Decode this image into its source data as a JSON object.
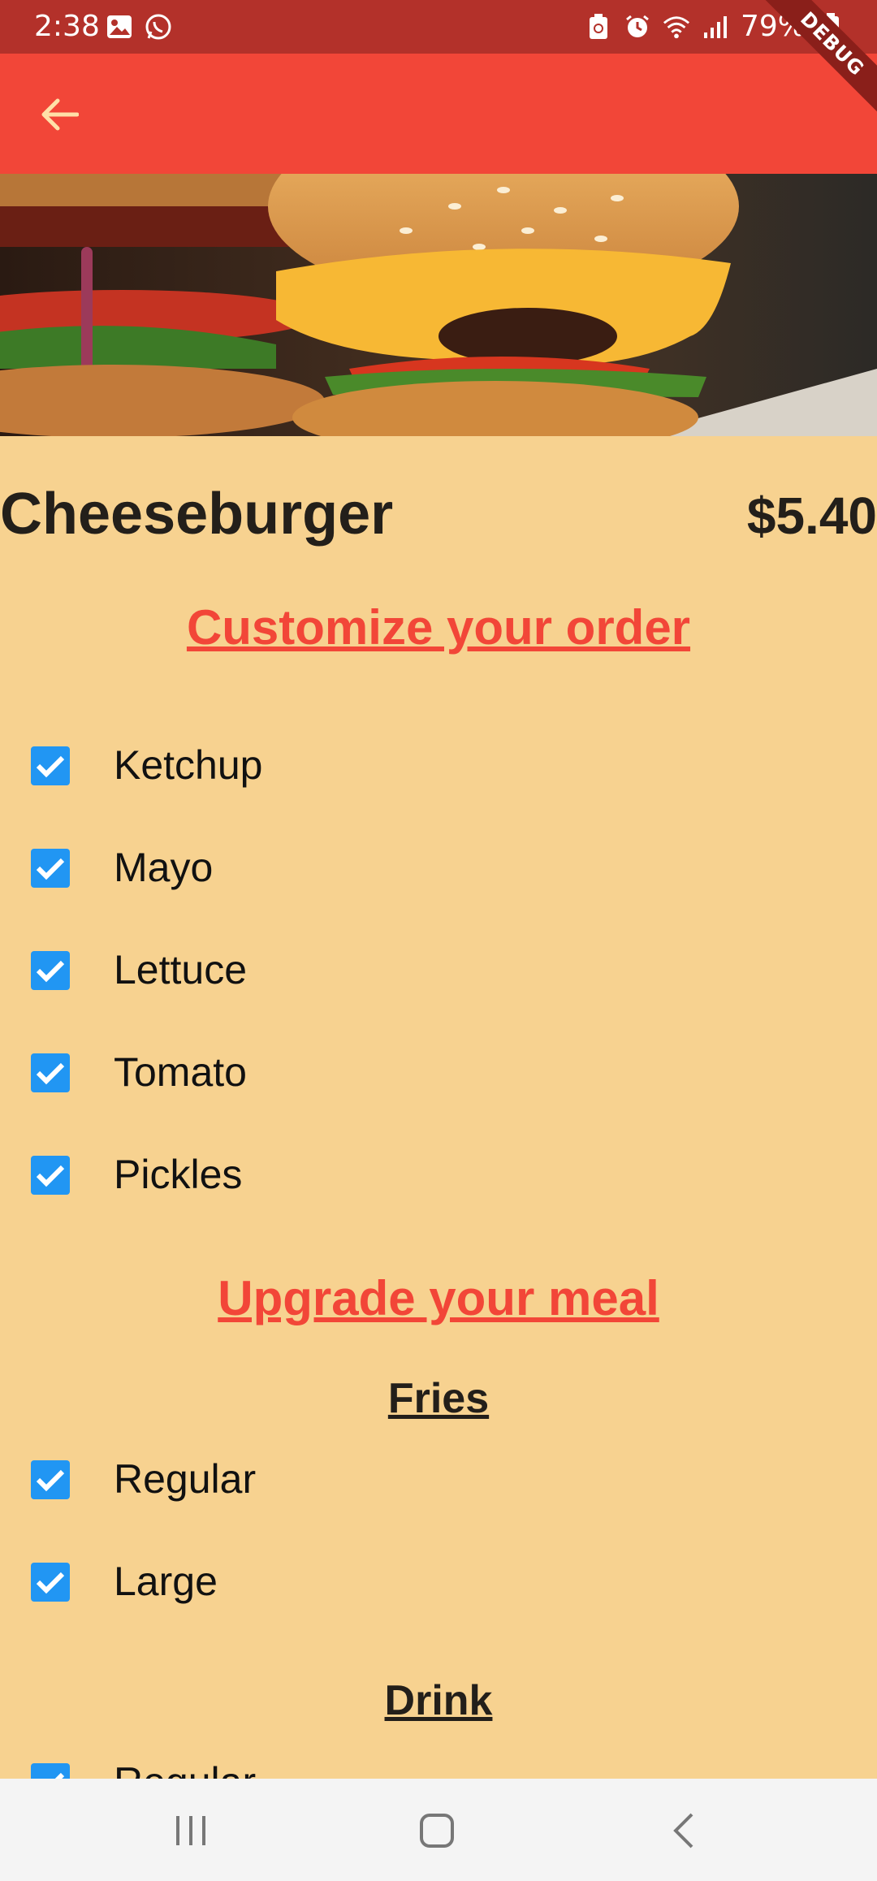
{
  "status_bar": {
    "time": "2:38",
    "battery": "79%",
    "left_icons": [
      "image-icon",
      "whatsapp-icon"
    ],
    "right_icons": [
      "battery-saver-icon",
      "alarm-icon",
      "wifi-icon",
      "signal-icon",
      "battery-icon"
    ]
  },
  "debug_banner": "DEBUG",
  "app_bar": {
    "back_icon": "arrow-back-icon",
    "accent": "#F24638"
  },
  "product": {
    "name": "Cheeseburger",
    "price": "$5.40"
  },
  "customize": {
    "heading": "Customize your order",
    "options": [
      {
        "label": "Ketchup",
        "checked": true
      },
      {
        "label": "Mayo",
        "checked": true
      },
      {
        "label": "Lettuce",
        "checked": true
      },
      {
        "label": "Tomato",
        "checked": true
      },
      {
        "label": "Pickles",
        "checked": true
      }
    ]
  },
  "upgrade": {
    "heading": "Upgrade your meal",
    "fries": {
      "heading": "Fries",
      "options": [
        {
          "label": "Regular",
          "checked": true
        },
        {
          "label": "Large",
          "checked": true
        }
      ]
    },
    "drink": {
      "heading": "Drink",
      "options": [
        {
          "label": "Regular",
          "checked": true
        }
      ]
    }
  },
  "nav_bar": {
    "icons": [
      "recent-apps-icon",
      "home-icon",
      "back-icon"
    ]
  },
  "colors": {
    "background": "#F7D290",
    "checkbox": "#2196F3",
    "status_bar": "#B3312A"
  }
}
